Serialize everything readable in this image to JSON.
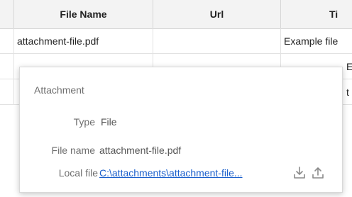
{
  "grid": {
    "columns": [
      "",
      "File Name",
      "Url",
      "Ti"
    ],
    "rows": [
      {
        "file_name": "attachment-file.pdf",
        "url": "",
        "title": "Example file"
      },
      {
        "file_name": "",
        "url": "",
        "title": "E"
      },
      {
        "file_name": "",
        "url": "",
        "title": "t"
      }
    ]
  },
  "popup": {
    "title": "Attachment",
    "fields": {
      "type_label": "Type",
      "type_value": "File",
      "file_name_label": "File name",
      "file_name_value": "attachment-file.pdf",
      "local_file_label": "Local file",
      "local_file_value": "C:\\attachments\\attachment-file..."
    },
    "icons": {
      "download": "download-icon",
      "upload": "upload-icon"
    }
  },
  "colors": {
    "header_bg": "#f3f3f3",
    "link": "#1a5fcc",
    "label": "#6e6e6e",
    "icon": "#8a8a8a"
  }
}
